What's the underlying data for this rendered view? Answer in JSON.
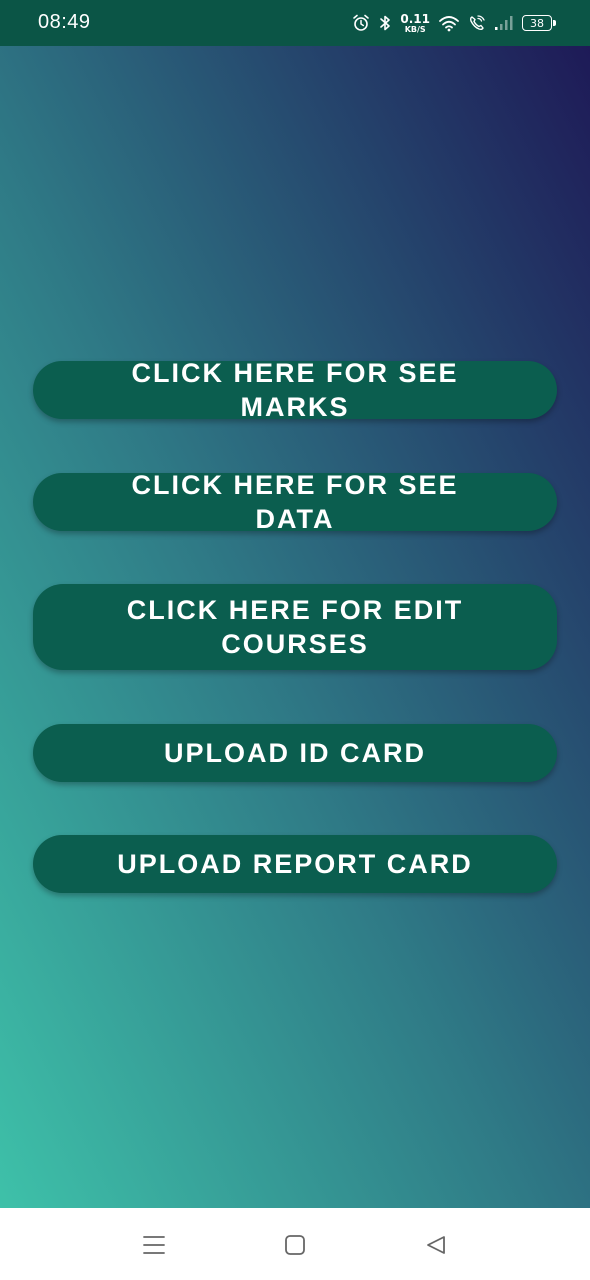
{
  "status_bar": {
    "time": "08:49",
    "net_speed_value": "0.11",
    "net_speed_unit": "KB/S",
    "battery_level": "38"
  },
  "buttons": [
    {
      "label": "CLICK HERE FOR SEE MARKS"
    },
    {
      "label": "CLICK HERE FOR SEE DATA"
    },
    {
      "label": "CLICK HERE FOR EDIT COURSES"
    },
    {
      "label": "UPLOAD ID CARD"
    },
    {
      "label": "UPLOAD REPORT CARD"
    }
  ],
  "colors": {
    "status_bar": "#0b5546",
    "button": "#0b5e4f",
    "gradient_top_right": "#1e1a57",
    "gradient_bottom_left": "#3ec1a9"
  },
  "nav_bar": {
    "icons": [
      "menu-icon",
      "home-square-icon",
      "back-triangle-icon"
    ]
  }
}
